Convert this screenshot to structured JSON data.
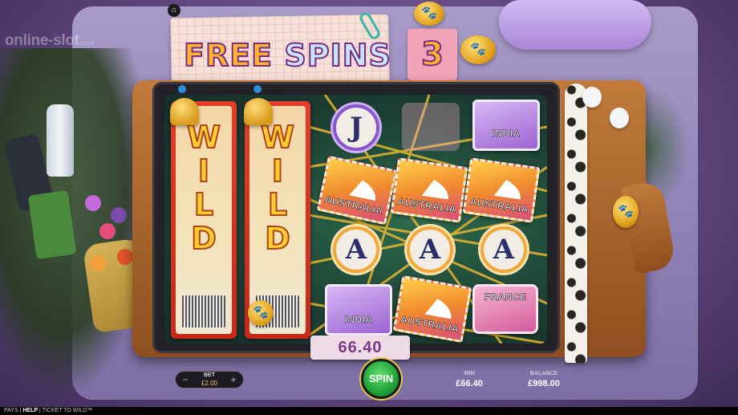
{
  "logo": {
    "text": "online-slot",
    "suffix": ".co.uk"
  },
  "top_controls": {
    "home_icon": "home-icon",
    "icons": [
      "info-icon",
      "sound-icon",
      "settings-icon",
      "history-icon",
      "fullscreen-icon"
    ]
  },
  "free_spins": {
    "word1": "FREE",
    "word2": "SPINS",
    "count": "3"
  },
  "reels": {
    "wild_label": "WILD",
    "wild_letters": [
      "W",
      "I",
      "L",
      "D"
    ],
    "symbols": {
      "row1": [
        "J",
        "",
        ""
      ],
      "row2_stamp": "AUSTRALIA",
      "row3": [
        "A",
        "A",
        "A"
      ],
      "row4_stamp": "AUSTRALIA",
      "india_stamp": "INDIA",
      "france_stamp": "FRANCE"
    }
  },
  "win_sticker": "66.40",
  "bet": {
    "label": "BET",
    "value": "£2.00",
    "minus": "−",
    "plus": "+"
  },
  "spin_button": "SPIN",
  "stats": {
    "win_label": "WIN",
    "win_value": "£66.40",
    "balance_label": "BALANCE",
    "balance_value": "£998.00"
  },
  "footer": {
    "pays": "PAYS",
    "help": "HELP",
    "title": "TICKET TO WILD™"
  },
  "colors": {
    "accent": "#ffb42a",
    "spin_green": "#1fa23a",
    "ticket_red": "#e63e2a"
  }
}
